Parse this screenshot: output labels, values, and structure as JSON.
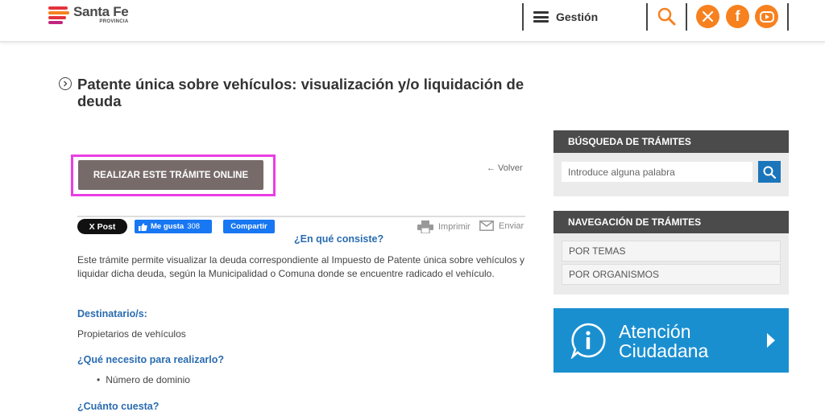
{
  "header": {
    "logo_title": "Santa Fe",
    "logo_subtitle": "PROVINCIA",
    "menu_label": "Gestión",
    "social": [
      "x-icon",
      "facebook-icon",
      "youtube-icon"
    ],
    "accent_color": "#f7811f"
  },
  "main": {
    "title": "Patente única sobre vehículos: visualización y/o liquidación de deuda",
    "online_button": "REALIZAR ESTE TRÁMITE ONLINE",
    "back_link": "← Volver",
    "share": {
      "x_post": "X Post",
      "fb_like": "Me gusta",
      "fb_like_count": "308",
      "fb_share": "Compartir",
      "print": "Imprimir",
      "send": "Enviar"
    },
    "what_heading": "¿En qué consiste?",
    "what_text": "Este trámite permite visualizar la deuda correspondiente al Impuesto de Patente única sobre vehículos y liquidar dicha deuda, según la Municipalidad o Comuna donde se encuentre radicado el vehículo.",
    "recipients_heading": "Destinatario/s:",
    "recipients_text": "Propietarios de vehículos",
    "requirements_heading": "¿Qué necesito para realizarlo?",
    "requirements": [
      "Número de dominio"
    ],
    "cost_heading": "¿Cuánto cuesta?"
  },
  "sidebar": {
    "search_heading": "BÚSQUEDA DE TRÁMITES",
    "search_placeholder": "Introduce alguna palabra",
    "nav_heading": "NAVEGACIÓN DE TRÁMITES",
    "nav_items": [
      "POR TEMAS",
      "POR ORGANISMOS"
    ],
    "attention_line1": "Atención",
    "attention_line2": "Ciudadana",
    "attention_color": "#1a8fd0"
  }
}
